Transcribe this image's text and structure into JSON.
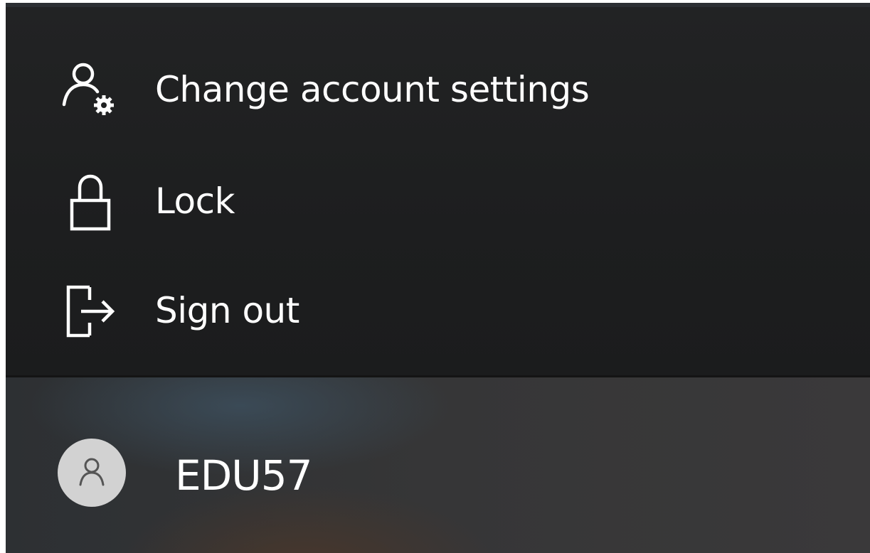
{
  "account_menu": {
    "items": [
      {
        "label": "Change account settings",
        "icon": "person-settings-icon"
      },
      {
        "label": "Lock",
        "icon": "lock-icon"
      },
      {
        "label": "Sign out",
        "icon": "sign-out-icon"
      }
    ]
  },
  "user": {
    "name": "EDU57",
    "avatar_icon": "person-icon"
  },
  "colors": {
    "menu_background": "#1f2021",
    "text": "#ffffff",
    "avatar_background": "#d2d2d2"
  }
}
